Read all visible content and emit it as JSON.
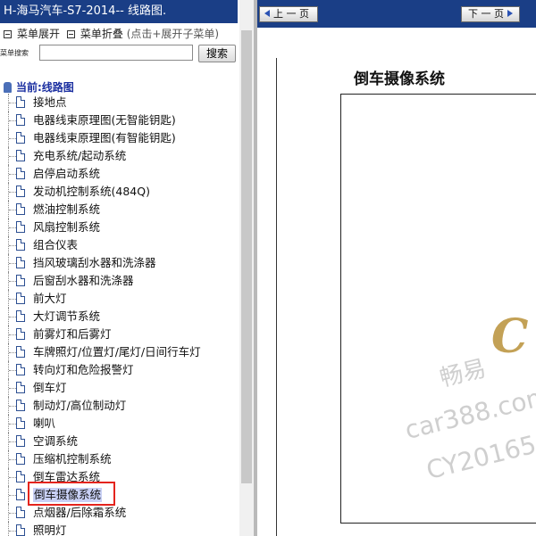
{
  "left_panel": {
    "title": "H-海马汽车-S7-2014-- 线路图.",
    "expand_label": "菜单展开",
    "collapse_label": "菜单折叠",
    "collapse_hint": "(点击+展开子菜单)",
    "search_label": "菜单搜索",
    "search_value": "",
    "search_button": "搜索",
    "tree_root": "当前:线路图",
    "items": [
      "接地点",
      "电器线束原理图(无智能钥匙)",
      "电器线束原理图(有智能钥匙)",
      "充电系统/起动系统",
      "启停启动系统",
      "发动机控制系统(484Q)",
      "燃油控制系统",
      "风扇控制系统",
      "组合仪表",
      "挡风玻璃刮水器和洗涤器",
      "后窗刮水器和洗涤器",
      "前大灯",
      "大灯调节系统",
      "前雾灯和后雾灯",
      "车牌照灯/位置灯/尾灯/日间行车灯",
      "转向灯和危险报警灯",
      "倒车灯",
      "制动灯/高位制动灯",
      "喇叭",
      "空调系统",
      "压缩机控制系统",
      "倒车雷达系统",
      "倒车摄像系统",
      "点烟器/后除霜系统",
      "照明灯"
    ],
    "selected_index": 22
  },
  "right_panel": {
    "prev_button": "上 一 页",
    "next_button": "下 一 页",
    "doc_title": "倒车摄像系统",
    "watermark": {
      "logo": "C",
      "line1": "畅易",
      "line2": "car388.com",
      "line3": "CY20165"
    }
  },
  "colors": {
    "header_blue": "#1a3e86",
    "selection_bg": "#c8d0f5",
    "highlight_red": "#e4241d"
  }
}
